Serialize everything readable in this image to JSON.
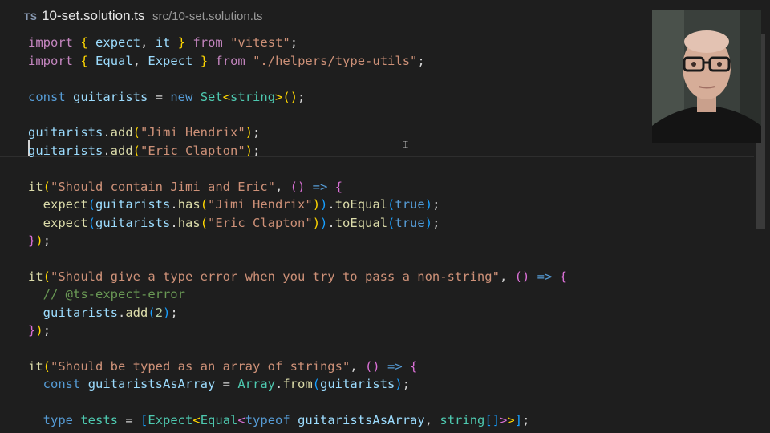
{
  "tab": {
    "lang_badge": "TS",
    "filename": "10-set.solution.ts",
    "path": "src/10-set.solution.ts"
  },
  "webcam": {
    "label": "presenter webcam"
  },
  "code": {
    "l1": [
      [
        "kw",
        "import"
      ],
      [
        "pl",
        " "
      ],
      [
        "br1",
        "{"
      ],
      [
        "pl",
        " "
      ],
      [
        "var",
        "expect"
      ],
      [
        "pl",
        ", "
      ],
      [
        "var",
        "it"
      ],
      [
        "pl",
        " "
      ],
      [
        "br1",
        "}"
      ],
      [
        "pl",
        " "
      ],
      [
        "kw",
        "from"
      ],
      [
        "pl",
        " "
      ],
      [
        "str",
        "\"vitest\""
      ],
      [
        "pl",
        ";"
      ]
    ],
    "l2": [
      [
        "kw",
        "import"
      ],
      [
        "pl",
        " "
      ],
      [
        "br1",
        "{"
      ],
      [
        "pl",
        " "
      ],
      [
        "var",
        "Equal"
      ],
      [
        "pl",
        ", "
      ],
      [
        "var",
        "Expect"
      ],
      [
        "pl",
        " "
      ],
      [
        "br1",
        "}"
      ],
      [
        "pl",
        " "
      ],
      [
        "kw",
        "from"
      ],
      [
        "pl",
        " "
      ],
      [
        "str",
        "\"./helpers/type-utils\""
      ],
      [
        "pl",
        ";"
      ]
    ],
    "l4": [
      [
        "kb",
        "const"
      ],
      [
        "pl",
        " "
      ],
      [
        "var",
        "guitarists"
      ],
      [
        "pl",
        " = "
      ],
      [
        "kb",
        "new"
      ],
      [
        "pl",
        " "
      ],
      [
        "type",
        "Set"
      ],
      [
        "br1",
        "<"
      ],
      [
        "type",
        "string"
      ],
      [
        "br1",
        ">"
      ],
      [
        "br1",
        "()"
      ],
      [
        "pl",
        ";"
      ]
    ],
    "l6": [
      [
        "var",
        "guitarists"
      ],
      [
        "pl",
        "."
      ],
      [
        "fn",
        "add"
      ],
      [
        "br1",
        "("
      ],
      [
        "str",
        "\"Jimi Hendrix\""
      ],
      [
        "br1",
        ")"
      ],
      [
        "pl",
        ";"
      ]
    ],
    "l7": [
      [
        "var",
        "guitarists"
      ],
      [
        "pl",
        "."
      ],
      [
        "fn",
        "add"
      ],
      [
        "br1",
        "("
      ],
      [
        "str",
        "\"Eric Clapton\""
      ],
      [
        "br1",
        ")"
      ],
      [
        "pl",
        ";"
      ]
    ],
    "l9": [
      [
        "fn",
        "it"
      ],
      [
        "br1",
        "("
      ],
      [
        "str",
        "\"Should contain Jimi and Eric\""
      ],
      [
        "pl",
        ", "
      ],
      [
        "br2",
        "()"
      ],
      [
        "pl",
        " "
      ],
      [
        "kb",
        "=>"
      ],
      [
        "pl",
        " "
      ],
      [
        "br2",
        "{"
      ]
    ],
    "l10": [
      [
        "pl",
        "  "
      ],
      [
        "fn",
        "expect"
      ],
      [
        "br3",
        "("
      ],
      [
        "var",
        "guitarists"
      ],
      [
        "pl",
        "."
      ],
      [
        "fn",
        "has"
      ],
      [
        "br1",
        "("
      ],
      [
        "str",
        "\"Jimi Hendrix\""
      ],
      [
        "br1",
        ")"
      ],
      [
        "br3",
        ")"
      ],
      [
        "pl",
        "."
      ],
      [
        "fn",
        "toEqual"
      ],
      [
        "br3",
        "("
      ],
      [
        "kb",
        "true"
      ],
      [
        "br3",
        ")"
      ],
      [
        "pl",
        ";"
      ]
    ],
    "l11": [
      [
        "pl",
        "  "
      ],
      [
        "fn",
        "expect"
      ],
      [
        "br3",
        "("
      ],
      [
        "var",
        "guitarists"
      ],
      [
        "pl",
        "."
      ],
      [
        "fn",
        "has"
      ],
      [
        "br1",
        "("
      ],
      [
        "str",
        "\"Eric Clapton\""
      ],
      [
        "br1",
        ")"
      ],
      [
        "br3",
        ")"
      ],
      [
        "pl",
        "."
      ],
      [
        "fn",
        "toEqual"
      ],
      [
        "br3",
        "("
      ],
      [
        "kb",
        "true"
      ],
      [
        "br3",
        ")"
      ],
      [
        "pl",
        ";"
      ]
    ],
    "l12": [
      [
        "br2",
        "}"
      ],
      [
        "br1",
        ")"
      ],
      [
        "pl",
        ";"
      ]
    ],
    "l14": [
      [
        "fn",
        "it"
      ],
      [
        "br1",
        "("
      ],
      [
        "str",
        "\"Should give a type error when you try to pass a non-string\""
      ],
      [
        "pl",
        ", "
      ],
      [
        "br2",
        "()"
      ],
      [
        "pl",
        " "
      ],
      [
        "kb",
        "=>"
      ],
      [
        "pl",
        " "
      ],
      [
        "br2",
        "{"
      ]
    ],
    "l15": [
      [
        "pl",
        "  "
      ],
      [
        "cm",
        "// @ts-expect-error"
      ]
    ],
    "l16": [
      [
        "pl",
        "  "
      ],
      [
        "var",
        "guitarists"
      ],
      [
        "pl",
        "."
      ],
      [
        "fn",
        "add"
      ],
      [
        "br3",
        "("
      ],
      [
        "num",
        "2"
      ],
      [
        "br3",
        ")"
      ],
      [
        "pl",
        ";"
      ]
    ],
    "l17": [
      [
        "br2",
        "}"
      ],
      [
        "br1",
        ")"
      ],
      [
        "pl",
        ";"
      ]
    ],
    "l19": [
      [
        "fn",
        "it"
      ],
      [
        "br1",
        "("
      ],
      [
        "str",
        "\"Should be typed as an array of strings\""
      ],
      [
        "pl",
        ", "
      ],
      [
        "br2",
        "()"
      ],
      [
        "pl",
        " "
      ],
      [
        "kb",
        "=>"
      ],
      [
        "pl",
        " "
      ],
      [
        "br2",
        "{"
      ]
    ],
    "l20": [
      [
        "pl",
        "  "
      ],
      [
        "kb",
        "const"
      ],
      [
        "pl",
        " "
      ],
      [
        "var",
        "guitaristsAsArray"
      ],
      [
        "pl",
        " = "
      ],
      [
        "type",
        "Array"
      ],
      [
        "pl",
        "."
      ],
      [
        "fn",
        "from"
      ],
      [
        "br3",
        "("
      ],
      [
        "var",
        "guitarists"
      ],
      [
        "br3",
        ")"
      ],
      [
        "pl",
        ";"
      ]
    ],
    "l22": [
      [
        "pl",
        "  "
      ],
      [
        "kb",
        "type"
      ],
      [
        "pl",
        " "
      ],
      [
        "type",
        "tests"
      ],
      [
        "pl",
        " = "
      ],
      [
        "br3",
        "["
      ],
      [
        "type",
        "Expect"
      ],
      [
        "br1",
        "<"
      ],
      [
        "type",
        "Equal"
      ],
      [
        "br2",
        "<"
      ],
      [
        "kb",
        "typeof"
      ],
      [
        "pl",
        " "
      ],
      [
        "var",
        "guitaristsAsArray"
      ],
      [
        "pl",
        ", "
      ],
      [
        "type",
        "string"
      ],
      [
        "br3",
        "[]"
      ],
      [
        "br2",
        ">"
      ],
      [
        "br1",
        ">"
      ],
      [
        "br3",
        "]"
      ],
      [
        "pl",
        ";"
      ]
    ]
  }
}
